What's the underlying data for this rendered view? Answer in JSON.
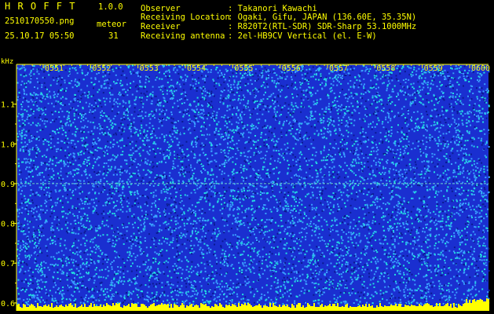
{
  "header": {
    "app_name": "H R O F F T",
    "version": "1.0.0",
    "filename": "2510170550.png",
    "datetime": "25.10.17 05:50",
    "meteor_label": "meteor",
    "meteor_count": "31",
    "info": [
      {
        "label": "Observer",
        "value": ": Takanori Kawachi"
      },
      {
        "label": "Receiving Location",
        "value": ": Ogaki, Gifu, JAPAN (136.60E, 35.35N)"
      },
      {
        "label": "Receiver",
        "value": ": R820T2(RTL-SDR) SDR-Sharp 53.1000MHz"
      },
      {
        "label": "Receiving antenna",
        "value": ": 2el-HB9CV Vertical (el. E-W)"
      }
    ]
  },
  "chart_data": {
    "type": "heatmap",
    "ylabel": "kHz",
    "x_ticks": [
      "0551",
      "0552",
      "0553",
      "0554",
      "0555",
      "0556",
      "0557",
      "0558",
      "0559",
      "0600"
    ],
    "y_ticks": [
      "1.1",
      "1.0",
      "0.9",
      "0.8",
      "0.7",
      "0.6"
    ],
    "ylim": [
      0.58,
      1.2
    ],
    "colors": {
      "background": "#1a2fd0",
      "noise_hi": "#22e0e0",
      "noise_mid": "#3aa0ff",
      "axis": "#ffff00",
      "carrier": "#ffff00"
    },
    "features": {
      "carrier_khz": 0.9,
      "baseline_khz": 0.6
    }
  }
}
